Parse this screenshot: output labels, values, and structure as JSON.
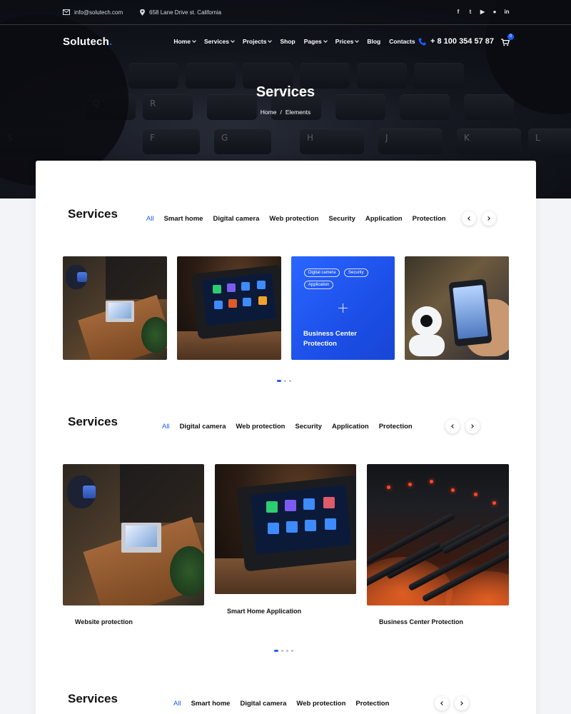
{
  "topbar": {
    "email": "info@solutech.com",
    "address": "658 Lane Drive st. California",
    "socials": [
      "facebook-icon",
      "twitter-icon",
      "youtube-icon",
      "github-icon",
      "linkedin-icon"
    ]
  },
  "nav": {
    "logo": "Solutech",
    "logo_dot": ".",
    "items": [
      {
        "label": "Home",
        "dropdown": true
      },
      {
        "label": "Services",
        "dropdown": true
      },
      {
        "label": "Projects",
        "dropdown": true
      },
      {
        "label": "Shop",
        "dropdown": false
      },
      {
        "label": "Pages",
        "dropdown": true
      },
      {
        "label": "Prices",
        "dropdown": true
      },
      {
        "label": "Blog",
        "dropdown": false
      },
      {
        "label": "Contacts",
        "dropdown": false
      }
    ],
    "phone": "+ 8 100 354 57 87",
    "cart_count": "0"
  },
  "hero": {
    "title": "Services",
    "breadcrumb": [
      "Home",
      "Elements"
    ],
    "breadcrumb_sep": "/"
  },
  "colors": {
    "accent": "#1e5bff",
    "dark": "#111111"
  },
  "section1": {
    "title": "Services",
    "tabs": [
      "All",
      "Smart home",
      "Digital camera",
      "Web protection",
      "Security",
      "Application",
      "Protection"
    ],
    "active_tab": "All",
    "featured": {
      "tags": [
        "Digital camera",
        "Security",
        "Application"
      ],
      "title_line1": "Business Center",
      "title_line2": "Protection"
    }
  },
  "section2": {
    "title": "Services",
    "tabs": [
      "All",
      "Digital camera",
      "Web protection",
      "Security",
      "Application",
      "Protection"
    ],
    "active_tab": "All",
    "items": [
      {
        "caption": "Website protection"
      },
      {
        "caption": "Smart Home Application"
      },
      {
        "caption": "Business Center Protection"
      }
    ]
  },
  "section3": {
    "title": "Services",
    "tabs": [
      "All",
      "Smart home",
      "Digital camera",
      "Web protection",
      "Protection"
    ],
    "active_tab": "All"
  }
}
